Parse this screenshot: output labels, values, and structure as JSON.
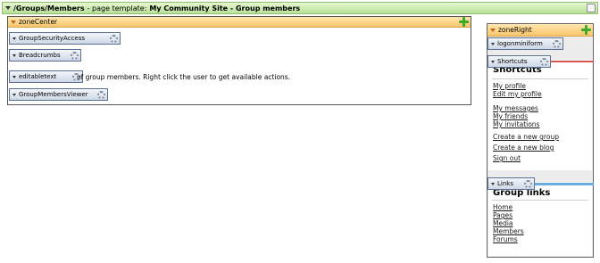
{
  "top_bar": {
    "path": "/Groups/Members",
    "separator": "- page template:",
    "template": "My Community Site - Group members"
  },
  "zone_center": {
    "title": "zoneCenter",
    "webparts": {
      "group_security_access": "GroupSecurityAccess",
      "breadcrumbs": "Breadcrumbs",
      "editable_text": "editabletext",
      "group_members_viewer": "GroupMembersViewer"
    },
    "text": "of group members. Right click the user to get available actions."
  },
  "zone_right": {
    "title": "zoneRight",
    "webparts": {
      "logon_mini_form": "logonminiform",
      "shortcuts": "Shortcuts",
      "links": "Links"
    },
    "shortcuts": {
      "title": "Shortcuts",
      "links": [
        "My profile",
        "Edit my profile",
        "My messages",
        "My friends",
        "My invitations",
        "Create a new group",
        "Create a new blog",
        "Sign out"
      ]
    },
    "group_links": {
      "title": "Group links",
      "links": [
        "Home",
        "Pages",
        "Media",
        "Members",
        "Forums"
      ]
    }
  },
  "colors": {
    "top_bar": "#b9e09a",
    "zone_header": "#f8c56b",
    "add_icon": "#3fa92b",
    "shortcuts_line": "#d65454",
    "links_line": "#6aaee0"
  },
  "icons": [
    "chevron-down-icon",
    "add-icon",
    "gear-icon",
    "expand-icon"
  ]
}
